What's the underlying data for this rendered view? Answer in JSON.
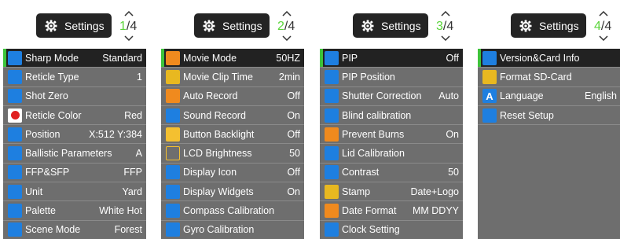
{
  "header": {
    "title": "Settings",
    "total_pages": "/4"
  },
  "colors": {
    "accent_green": "#3ec43a",
    "page_number_green": "#5ad43a",
    "icon_blue": "#1e7fe0"
  },
  "panels": [
    {
      "page": "1",
      "rows": [
        {
          "label": "Sharp Mode",
          "value": "Standard",
          "icon": "eye-icon",
          "selected": true
        },
        {
          "label": "Reticle Type",
          "value": "1",
          "icon": "crosshair-icon"
        },
        {
          "label": "Shot Zero",
          "value": "",
          "icon": "target-icon"
        },
        {
          "label": "Reticle Color",
          "value": "Red",
          "icon": "color-dot-icon"
        },
        {
          "label": "Position",
          "value": "X:512 Y:384",
          "icon": "position-icon"
        },
        {
          "label": "Ballistic Parameters",
          "value": "A",
          "icon": "ballistic-curve-icon"
        },
        {
          "label": "FFP&SFP",
          "value": "FFP",
          "icon": "ffp-sfp-icon"
        },
        {
          "label": "Unit",
          "value": "Yard",
          "icon": "ruler-icon"
        },
        {
          "label": "Palette",
          "value": "White Hot",
          "icon": "palette-icon"
        },
        {
          "label": "Scene Mode",
          "value": "Forest",
          "icon": "scene-icon"
        }
      ]
    },
    {
      "page": "2",
      "rows": [
        {
          "label": "Movie Mode",
          "value": "50HZ",
          "icon": "camera-icon",
          "selected": true
        },
        {
          "label": "Movie Clip Time",
          "value": "2min",
          "icon": "clip-time-icon"
        },
        {
          "label": "Auto Record",
          "value": "Off",
          "icon": "auto-record-icon"
        },
        {
          "label": "Sound Record",
          "value": "On",
          "icon": "microphone-icon"
        },
        {
          "label": "Button Backlight",
          "value": "Off",
          "icon": "backlight-icon"
        },
        {
          "label": "LCD Brightness",
          "value": "50",
          "icon": "brightness-icon"
        },
        {
          "label": "Display Icon",
          "value": "Off",
          "icon": "display-icon-icon"
        },
        {
          "label": "Display Widgets",
          "value": "On",
          "icon": "widgets-icon"
        },
        {
          "label": "Compass Calibration",
          "value": "",
          "icon": "compass-icon"
        },
        {
          "label": "Gyro Calibration",
          "value": "",
          "icon": "gyro-icon"
        }
      ]
    },
    {
      "page": "3",
      "rows": [
        {
          "label": "PIP",
          "value": "Off",
          "icon": "pip-icon",
          "selected": true
        },
        {
          "label": "PIP Position",
          "value": "",
          "icon": "pip-position-icon"
        },
        {
          "label": "Shutter Correction",
          "value": "Auto",
          "icon": "shutter-icon"
        },
        {
          "label": "Blind calibration",
          "value": "",
          "icon": "blind-calibration-icon"
        },
        {
          "label": "Prevent Burns",
          "value": "On",
          "icon": "prevent-burns-icon"
        },
        {
          "label": "Lid Calibration",
          "value": "",
          "icon": "lid-icon"
        },
        {
          "label": "Contrast",
          "value": "50",
          "icon": "contrast-icon"
        },
        {
          "label": "Stamp",
          "value": "Date+Logo",
          "icon": "stamp-icon"
        },
        {
          "label": "Date Format",
          "value": "MM DDYY",
          "icon": "calendar-icon"
        },
        {
          "label": "Clock Setting",
          "value": "",
          "icon": "clock-icon"
        }
      ]
    },
    {
      "page": "4",
      "rows": [
        {
          "label": "Version&Card Info",
          "value": "",
          "icon": "info-icon",
          "selected": true
        },
        {
          "label": "Format SD-Card",
          "value": "",
          "icon": "folder-icon"
        },
        {
          "label": "Language",
          "value": "English",
          "icon": "language-icon",
          "glyph": "A"
        },
        {
          "label": "Reset Setup",
          "value": "",
          "icon": "reset-icon"
        }
      ]
    }
  ]
}
